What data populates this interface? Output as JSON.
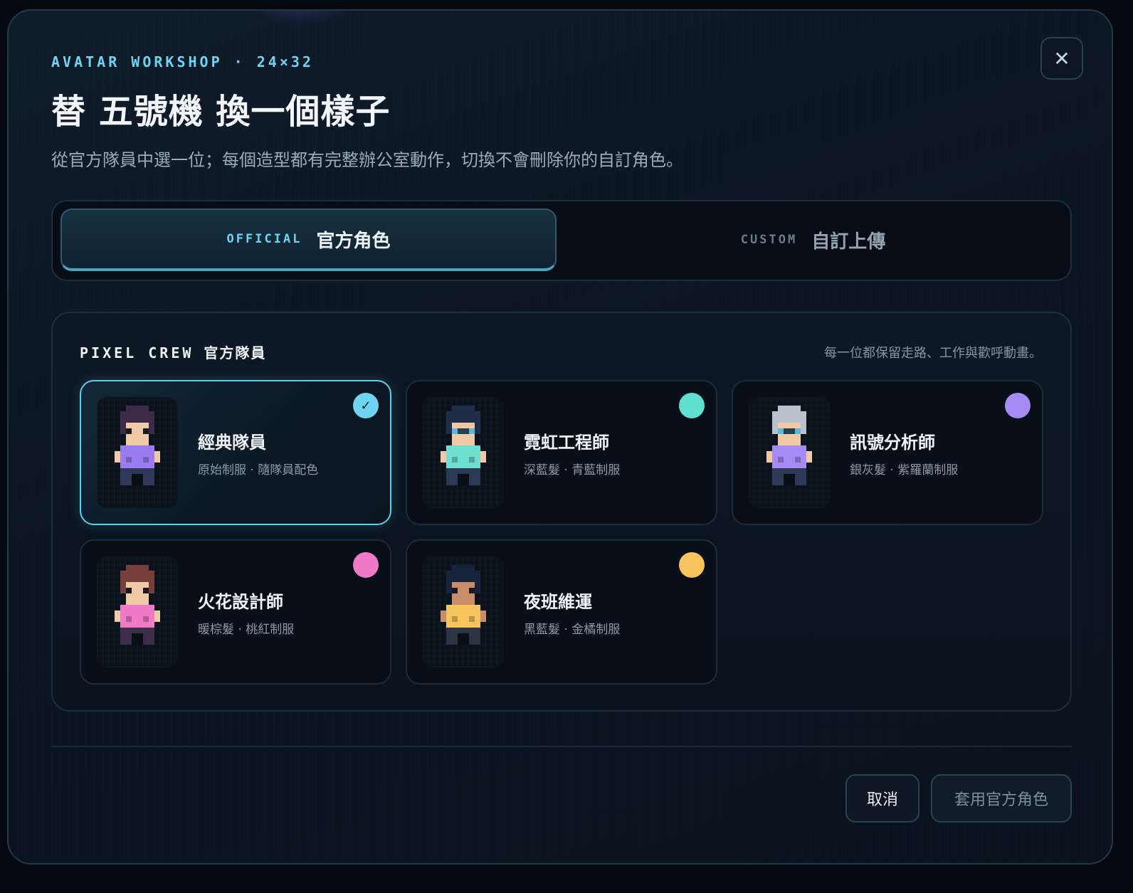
{
  "header": {
    "eyebrow": "AVATAR WORKSHOP · 24×32",
    "title": "替 五號機 換一個樣子",
    "subtitle": "從官方隊員中選一位；每個造型都有完整辦公室動作，切換不會刪除你的自訂角色。",
    "close_icon": "✕"
  },
  "tabs": [
    {
      "code": "OFFICIAL",
      "label": "官方角色",
      "active": true
    },
    {
      "code": "CUSTOM",
      "label": "自訂上傳",
      "active": false
    }
  ],
  "crew": {
    "title_code": "PIXEL CREW",
    "title_label": "官方隊員",
    "note": "每一位都保留走路、工作與歡呼動畫。",
    "selected_check": "✓",
    "cards": [
      {
        "name": "經典隊員",
        "desc": "原始制服 · 隨隊員配色",
        "accent": "#6fd3f2",
        "hair": "#3d2a4a",
        "skin": "#f0c9a6",
        "shirt": "#9b7cf0",
        "pants": "#2e3a58",
        "eyewear": false,
        "selected": true
      },
      {
        "name": "霓虹工程師",
        "desc": "深藍髮 · 青藍制服",
        "accent": "#5fe0d0",
        "hair": "#1f2d48",
        "skin": "#f0c9a6",
        "shirt": "#6fe0d0",
        "pants": "#2a3a55",
        "eyewear": true,
        "selected": false
      },
      {
        "name": "訊號分析師",
        "desc": "銀灰髮 · 紫羅蘭制服",
        "accent": "#a58cf5",
        "hair": "#b9c1cc",
        "skin": "#f0c9a6",
        "shirt": "#a58cf5",
        "pants": "#2e3a58",
        "eyewear": true,
        "selected": false
      },
      {
        "name": "火花設計師",
        "desc": "暖棕髮 · 桃紅制服",
        "accent": "#f07ac8",
        "hair": "#7a3e3a",
        "skin": "#f0c9a6",
        "shirt": "#f07ac8",
        "pants": "#3a2e48",
        "eyewear": false,
        "selected": false
      },
      {
        "name": "夜班維運",
        "desc": "黑藍髮 · 金橘制服",
        "accent": "#f7c45e",
        "hair": "#17233a",
        "skin": "#c98d68",
        "shirt": "#f7c45e",
        "pants": "#2a3444",
        "eyewear": false,
        "selected": false
      }
    ]
  },
  "footer": {
    "cancel_label": "取消",
    "apply_label": "套用官方角色"
  }
}
